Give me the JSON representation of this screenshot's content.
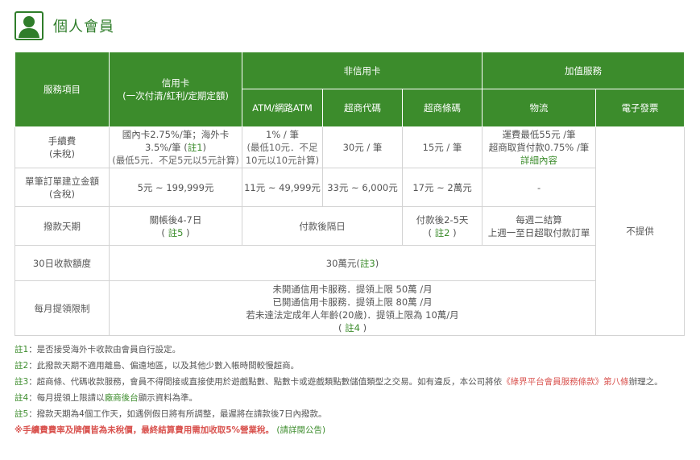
{
  "header": {
    "title": "個人會員",
    "icon": "user-avatar-icon"
  },
  "colors": {
    "accent": "#3c8c2c",
    "link": "#d9534f"
  },
  "table": {
    "col_service": "服務項目",
    "col_credit_line1": "信用卡",
    "col_credit_line2": "(一次付清/紅利/定期定額)",
    "col_noncredit": "非信用卡",
    "col_addon": "加值服務",
    "sub_atm": "ATM/網路ATM",
    "sub_cvs_code": "超商代碼",
    "sub_cvs_barcode": "超商條碼",
    "sub_logistics": "物流",
    "sub_einvoice": "電子發票",
    "rows": {
      "fee": {
        "label1": "手續費",
        "label2": "(未稅)",
        "credit_line1": "國內卡2.75%/筆；海外卡",
        "credit_line2a": "3.5%/筆 (",
        "credit_note": "註1",
        "credit_line2b": ")",
        "credit_line3": "(最低5元．不足5元以5元計算)",
        "atm_line1": "1% / 筆",
        "atm_line2": "(最低10元．不足",
        "atm_line3": "10元以10元計算)",
        "cvs_code": "30元 / 筆",
        "cvs_barcode": "15元 / 筆",
        "logistics_line1": "運費最低55元 /筆",
        "logistics_line2": "超商取貨付款0.75% /筆",
        "logistics_link": "詳細內容"
      },
      "amount": {
        "label1": "單筆訂單建立金額",
        "label2": "(含稅)",
        "credit": "5元 ~ 199,999元",
        "atm": "11元 ~ 49,999元",
        "cvs_code": "33元 ~ 6,000元",
        "cvs_barcode": "17元 ~ 2萬元",
        "logistics": "-"
      },
      "payout": {
        "label": "撥款天期",
        "credit_line1": "關帳後4-7日",
        "credit_note": "註5",
        "noncredit": "付款後隔日",
        "barcode_line1": "付款後2-5天",
        "barcode_note": "註2",
        "logistics_line1": "每週二結算",
        "logistics_line2": "上週一至日超取付款訂單",
        "einvoice": "不提供"
      },
      "limit30": {
        "label": "30日收款額度",
        "value": "30萬元(",
        "note": "註3",
        "close": ")"
      },
      "monthly": {
        "label": "每月提領限制",
        "line1": "未開通信用卡服務．提領上限 50萬 /月",
        "line2": "已開通信用卡服務．提領上限 80萬 /月",
        "line3": "若未達法定成年人年齡(20歲)．提領上限為 10萬/月",
        "note": "註4"
      }
    }
  },
  "notes": {
    "n1_label": "註1",
    "n1_text": "：是否接受海外卡收款由會員自行設定。",
    "n2_label": "註2",
    "n2_text": "：此撥款天期不適用離島、偏遠地區，以及其他少數入帳時間較慢超商。",
    "n3_label": "註3",
    "n3_text": "：超商條、代碼收款服務，會員不得間接或直接使用於遊戲點數、點數卡或遊戲類點數儲值類型之交易。如有違反，本公司將依",
    "n3_link": "《綠界平台會員服務條款》第八條",
    "n3_tail": "辦理之。",
    "n4_label": "註4",
    "n4_text_a": "：每月提領上限請以",
    "n4_link": "廠商後台",
    "n4_text_b": "顯示資料為準。",
    "n5_label": "註5",
    "n5_text": "：撥款天期為4個工作天，如遇例假日將有所調整，最遲將在請款後7日內撥款。",
    "warn": "※手續費費率及牌價皆為未稅價，最終結算費用需加收取5%營業稅。",
    "warn_link": "(請詳閱公告)"
  }
}
